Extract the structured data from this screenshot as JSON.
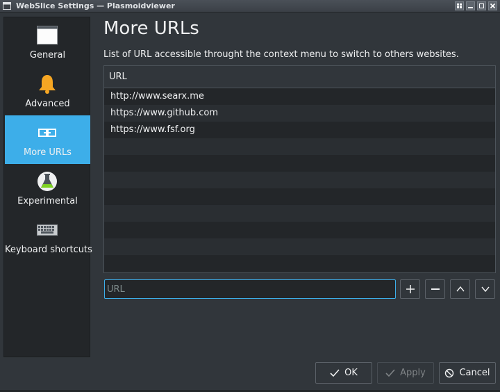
{
  "window": {
    "title": "WebSlice Settings — Plasmoidviewer"
  },
  "sidebar": {
    "items": [
      {
        "label": "General",
        "icon": "window-icon"
      },
      {
        "label": "Advanced",
        "icon": "bell-icon"
      },
      {
        "label": "More URLs",
        "icon": "link-icon"
      },
      {
        "label": "Experimental",
        "icon": "flask-icon"
      },
      {
        "label": "Keyboard shortcuts",
        "icon": "keyboard-icon"
      }
    ],
    "active_index": 2
  },
  "main": {
    "title": "More URLs",
    "description": "List of URL accessible throught the context menu to switch to others websites.",
    "table": {
      "header": "URL",
      "rows": [
        "http://www.searx.me",
        "https://www.github.com",
        "https://www.fsf.org"
      ]
    },
    "input": {
      "placeholder": "URL",
      "value": ""
    }
  },
  "buttons": {
    "ok": "OK",
    "apply": "Apply",
    "cancel": "Cancel"
  },
  "colors": {
    "accent": "#3daee9",
    "background": "#31363b",
    "view_background": "#232629",
    "text": "#eff0f1"
  }
}
